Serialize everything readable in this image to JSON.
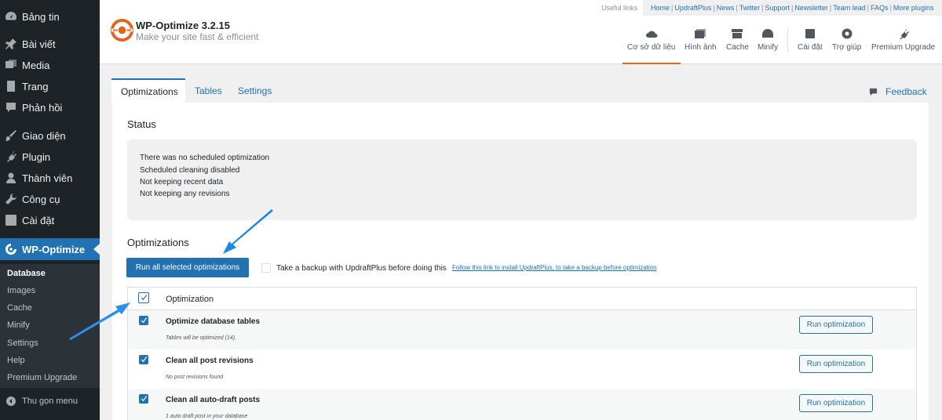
{
  "sidebar": {
    "items": [
      {
        "label": "Bảng tin",
        "icon": "dashboard-icon"
      },
      {
        "label": "Bài viết",
        "icon": "pin-icon"
      },
      {
        "label": "Media",
        "icon": "media-icon"
      },
      {
        "label": "Trang",
        "icon": "page-icon"
      },
      {
        "label": "Phản hồi",
        "icon": "comment-icon"
      },
      {
        "label": "Giao diện",
        "icon": "brush-icon"
      },
      {
        "label": "Plugin",
        "icon": "plugin-icon"
      },
      {
        "label": "Thành viên",
        "icon": "user-icon"
      },
      {
        "label": "Công cụ",
        "icon": "wrench-icon"
      },
      {
        "label": "Cài đặt",
        "icon": "settings-icon"
      },
      {
        "label": "WP-Optimize",
        "icon": "wpo-icon"
      }
    ],
    "submenu": [
      "Database",
      "Images",
      "Cache",
      "Minify",
      "Settings",
      "Help",
      "Premium Upgrade"
    ],
    "collapse_label": "Thu gọn menu"
  },
  "header": {
    "title": "WP-Optimize 3.2.15",
    "subtitle": "Make your site fast & efficient",
    "useful_links_label": "Useful links",
    "useful_links": [
      "Home",
      "UpdraftPlus",
      "News",
      "Twitter",
      "Support",
      "Newsletter",
      "Team lead",
      "FAQs",
      "More plugins"
    ],
    "nav": [
      {
        "label": "Cơ sở dữ liệu",
        "icon": "cloud-icon"
      },
      {
        "label": "Hình ảnh",
        "icon": "images-icon"
      },
      {
        "label": "Cache",
        "icon": "archive-icon"
      },
      {
        "label": "Minify",
        "icon": "dashboard-gauge-icon"
      },
      {
        "label": "Cài đặt",
        "icon": "admin-generic-icon"
      },
      {
        "label": "Trợ giúp",
        "icon": "lifebuoy-icon"
      },
      {
        "label": "Premium Upgrade",
        "icon": "plugin-upgrade-icon"
      }
    ]
  },
  "tabs": [
    "Optimizations",
    "Tables",
    "Settings"
  ],
  "feedback_label": "Feedback",
  "status": {
    "title": "Status",
    "lines": [
      "There was no scheduled optimization",
      "Scheduled cleaning disabled",
      "Not keeping recent data",
      "Not keeping any revisions"
    ]
  },
  "optimizations": {
    "title": "Optimizations",
    "run_all_label": "Run all selected optimizations",
    "backup_text": "Take a backup with UpdraftPlus before doing this",
    "backup_link": "Follow this link to install UpdraftPlus, to take a backup before optimization",
    "table_header": "Optimization",
    "rows": [
      {
        "title": "Optimize database tables",
        "desc": "Tables will be optimized (14).",
        "button": "Run optimization",
        "checked": true
      },
      {
        "title": "Clean all post revisions",
        "desc": "No post revisions found",
        "button": "Run optimization",
        "checked": true
      },
      {
        "title": "Clean all auto-draft posts",
        "desc": "1 auto draft post in your database",
        "button": "Run optimization",
        "checked": true
      }
    ]
  },
  "colors": {
    "accent": "#2271b1",
    "brand": "#e2651e",
    "sidebar_bg": "#1d2327"
  }
}
